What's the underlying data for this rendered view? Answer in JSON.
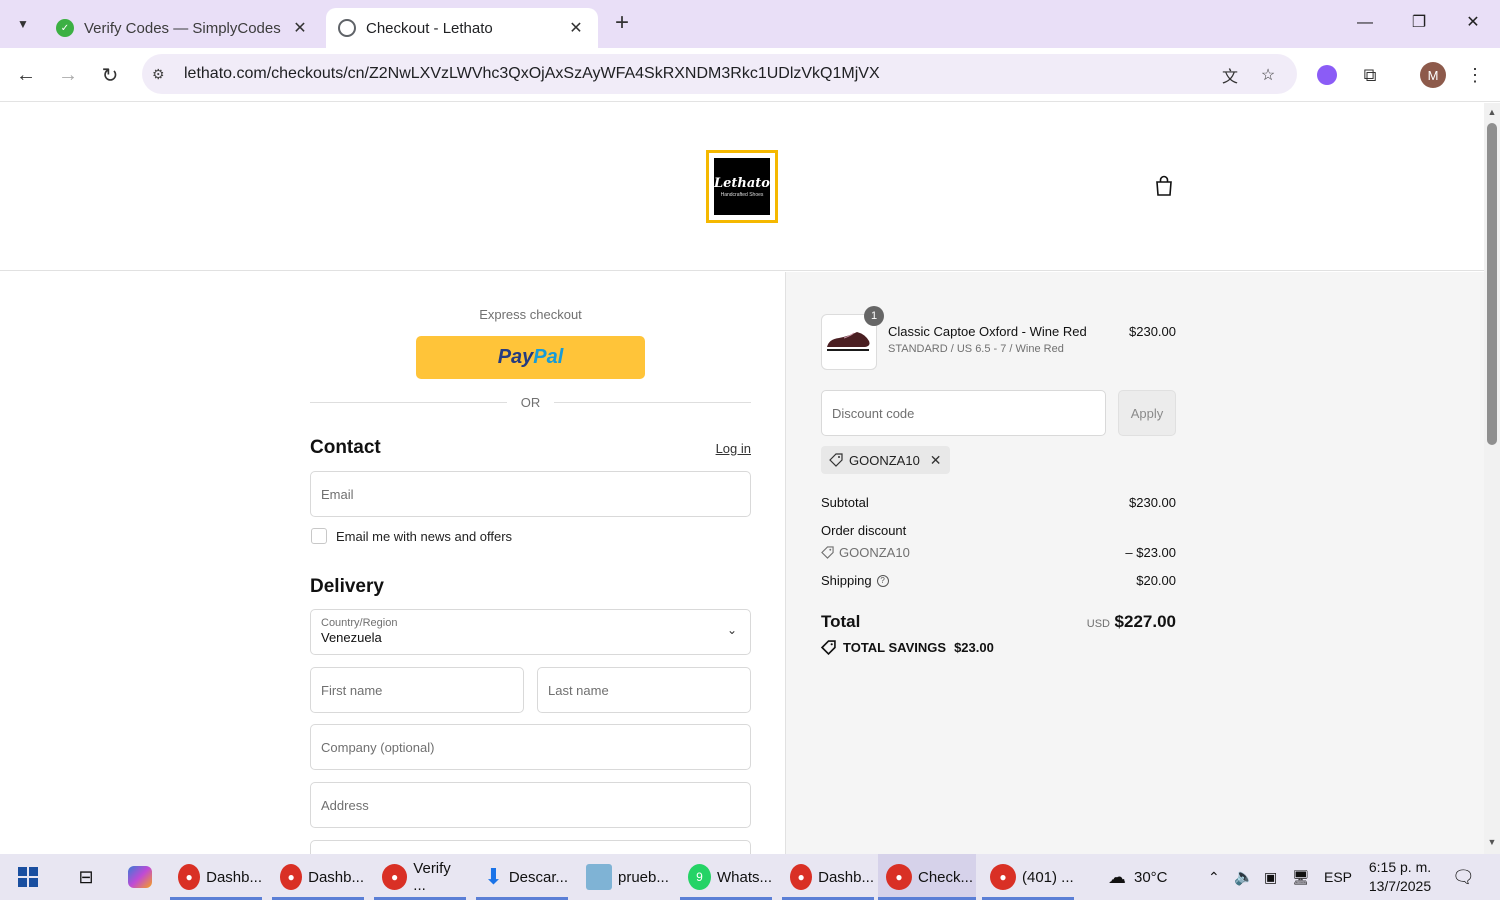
{
  "browser": {
    "tabs": [
      {
        "title": "Verify Codes — SimplyCodes",
        "active": false,
        "icon": "simplycodes-icon"
      },
      {
        "title": "Checkout - Lethato",
        "active": true,
        "icon": "globe-icon"
      }
    ],
    "url": "lethato.com/checkouts/cn/Z2NwLXVzLWVhc3QxOjAxSzAyWFA4SkRXNDM3Rkc1UDlzVkQ1MjVX",
    "profile_initial": "M"
  },
  "store": {
    "logo_text": "Lethato",
    "logo_subtext": "Handcrafted Shoes"
  },
  "checkout": {
    "express_label": "Express checkout",
    "paypal_label_1": "Pay",
    "paypal_label_2": "Pal",
    "or_label": "OR",
    "contact": {
      "title": "Contact",
      "login_link": "Log in",
      "email_placeholder": "Email",
      "newsletter_label": "Email me with news and offers"
    },
    "delivery": {
      "title": "Delivery",
      "country_label": "Country/Region",
      "country_value": "Venezuela",
      "first_name_placeholder": "First name",
      "last_name_placeholder": "Last name",
      "company_placeholder": "Company (optional)",
      "address_placeholder": "Address"
    }
  },
  "summary": {
    "product": {
      "quantity": "1",
      "name": "Classic Captoe Oxford - Wine Red",
      "variant": "STANDARD / US 6.5 - 7 / Wine Red",
      "price": "$230.00"
    },
    "discount_placeholder": "Discount code",
    "apply_label": "Apply",
    "applied_code": "GOONZA10",
    "subtotal_label": "Subtotal",
    "subtotal_value": "$230.00",
    "order_discount_label": "Order discount",
    "discount_code_line": "GOONZA10",
    "discount_value": "– $23.00",
    "shipping_label": "Shipping",
    "shipping_value": "$20.00",
    "total_label": "Total",
    "currency": "USD",
    "total_value": "$227.00",
    "savings_label": "TOTAL SAVINGS",
    "savings_value": "$23.00"
  },
  "taskbar": {
    "items": [
      {
        "label": "Dashb...",
        "badge": ""
      },
      {
        "label": "Dashb...",
        "badge": ""
      },
      {
        "label": "Verify ...",
        "badge": ""
      },
      {
        "label": "Descar...",
        "badge": ""
      },
      {
        "label": "prueb...",
        "badge": ""
      },
      {
        "label": "Whats...",
        "badge": "9"
      },
      {
        "label": "Dashb...",
        "badge": ""
      },
      {
        "label": "Check...",
        "badge": ""
      },
      {
        "label": "(401) ...",
        "badge": ""
      }
    ],
    "weather": "30°C",
    "language": "ESP",
    "time": "6:15 p. m.",
    "date": "13/7/2025"
  }
}
